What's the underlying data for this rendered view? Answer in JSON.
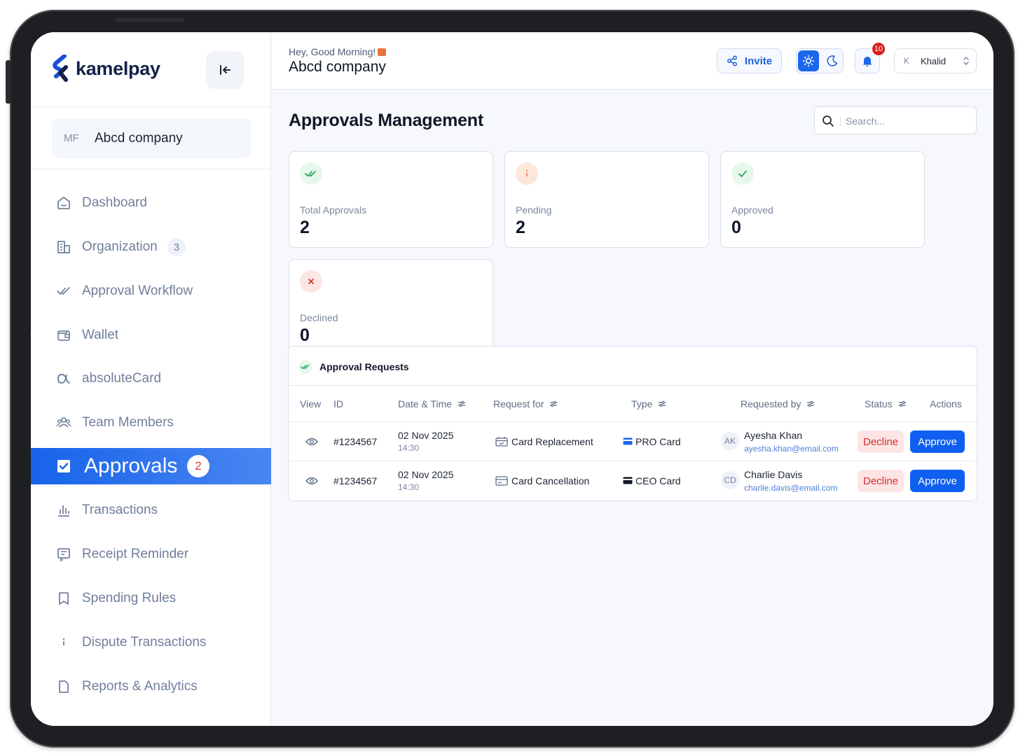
{
  "brand": {
    "name": "kamelpay",
    "primary": "#1763ea",
    "dark": "#16204a"
  },
  "sidebar": {
    "company": {
      "initials": "MF",
      "name": "Abcd company"
    },
    "items": [
      {
        "label": "Dashboard",
        "icon": "home-icon"
      },
      {
        "label": "Organization",
        "icon": "building-icon",
        "badge": "3"
      },
      {
        "label": "Approval Workflow",
        "icon": "double-check-icon"
      },
      {
        "label": "Wallet",
        "icon": "wallet-icon"
      },
      {
        "label": "absoluteCard",
        "icon": "alpha-icon"
      },
      {
        "label": "Team Members",
        "icon": "users-icon"
      },
      {
        "label": "Approvals",
        "icon": "checkbox-icon",
        "badge": "2",
        "active": true
      },
      {
        "label": "Transactions",
        "icon": "bar-chart-icon"
      },
      {
        "label": "Receipt Reminder",
        "icon": "receipt-icon"
      },
      {
        "label": "Spending Rules",
        "icon": "bookmark-icon"
      },
      {
        "label": "Dispute Transactions",
        "icon": "info-icon"
      },
      {
        "label": "Reports & Analytics",
        "icon": "document-icon"
      }
    ]
  },
  "header": {
    "greeting": "Hey, Good Morning!",
    "company": "Abcd company",
    "invite_label": "Invite",
    "notification_count": "10",
    "user": {
      "initial": "K",
      "name": "Khalid"
    }
  },
  "main": {
    "title": "Approvals Management",
    "search": {
      "placeholder": "Search...",
      "value": ""
    },
    "stats": [
      {
        "label": "Total Approvals",
        "value": "2",
        "icon": "double-check-icon",
        "color": "#1f9d55"
      },
      {
        "label": "Pending",
        "value": "2",
        "icon": "info-icon",
        "color": "#e9743c"
      },
      {
        "label": "Approved",
        "value": "0",
        "icon": "check-icon",
        "color": "#1f9d55"
      },
      {
        "label": "Declined",
        "value": "0",
        "icon": "close-icon",
        "color": "#d92d2d"
      }
    ],
    "requests": {
      "title": "Approval Requests",
      "columns": [
        "View",
        "ID",
        "Date & Time",
        "Request for",
        "Type",
        "Requested by",
        "Status",
        "Actions"
      ],
      "rows": [
        {
          "id": "#1234567",
          "date": "02 Nov 2025",
          "time": "14:30",
          "request_for": "Card Replacement",
          "type": "PRO Card",
          "initials": "AK",
          "name": "Ayesha Khan",
          "email": "ayesha.khan@email.com",
          "decline_label": "Decline",
          "approve_label": "Approve"
        },
        {
          "id": "#1234567",
          "date": "02 Nov 2025",
          "time": "14:30",
          "request_for": "Card Cancellation",
          "type": "CEO Card",
          "initials": "CD",
          "name": "Charlie Davis",
          "email": "charlie.davis@email.com",
          "decline_label": "Decline",
          "approve_label": "Approve"
        }
      ]
    }
  }
}
